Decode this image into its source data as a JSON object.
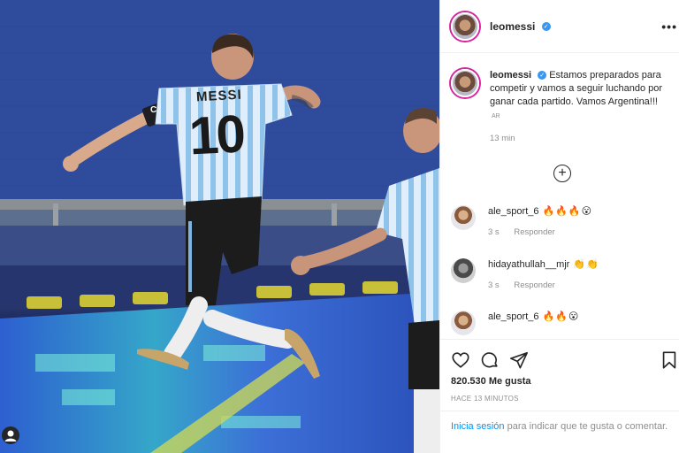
{
  "post": {
    "username": "leomessi",
    "verified": true,
    "more_label": "•••"
  },
  "caption": {
    "username": "leomessi",
    "text": "Estamos preparados para competir y vamos a seguir luchando por ganar cada partido. Vamos Argentina!!!",
    "translate_flag": "AR",
    "time": "13 min"
  },
  "load_more": {
    "label": "+"
  },
  "comments": [
    {
      "username": "ale_sport_6",
      "emojis": "🔥🔥🔥😮",
      "time": "3 s",
      "reply": "Responder"
    },
    {
      "username": "hidayathullah__mjr",
      "emojis": "👏👏",
      "time": "3 s",
      "reply": "Responder"
    },
    {
      "username": "ale_sport_6",
      "emojis": "🔥🔥😮",
      "time": "",
      "reply": ""
    }
  ],
  "engagement": {
    "likes": "820.530 Me gusta",
    "posted": "HACE 13 MINUTOS"
  },
  "login_prompt": {
    "link": "Inicia sesión",
    "text": " para indicar que te gusta o comentar."
  },
  "photo": {
    "jersey_name": "MESSI",
    "jersey_number": "10",
    "armband_letter": "C"
  },
  "colors": {
    "link": "#0095f6",
    "verified": "#3897f0",
    "muted": "#8e8e8e",
    "text": "#262626"
  },
  "icons": [
    "heart-icon",
    "comment-icon",
    "share-icon",
    "bookmark-icon",
    "add-circle-icon",
    "more-options-icon",
    "verified-badge-icon",
    "user-tag-icon"
  ]
}
